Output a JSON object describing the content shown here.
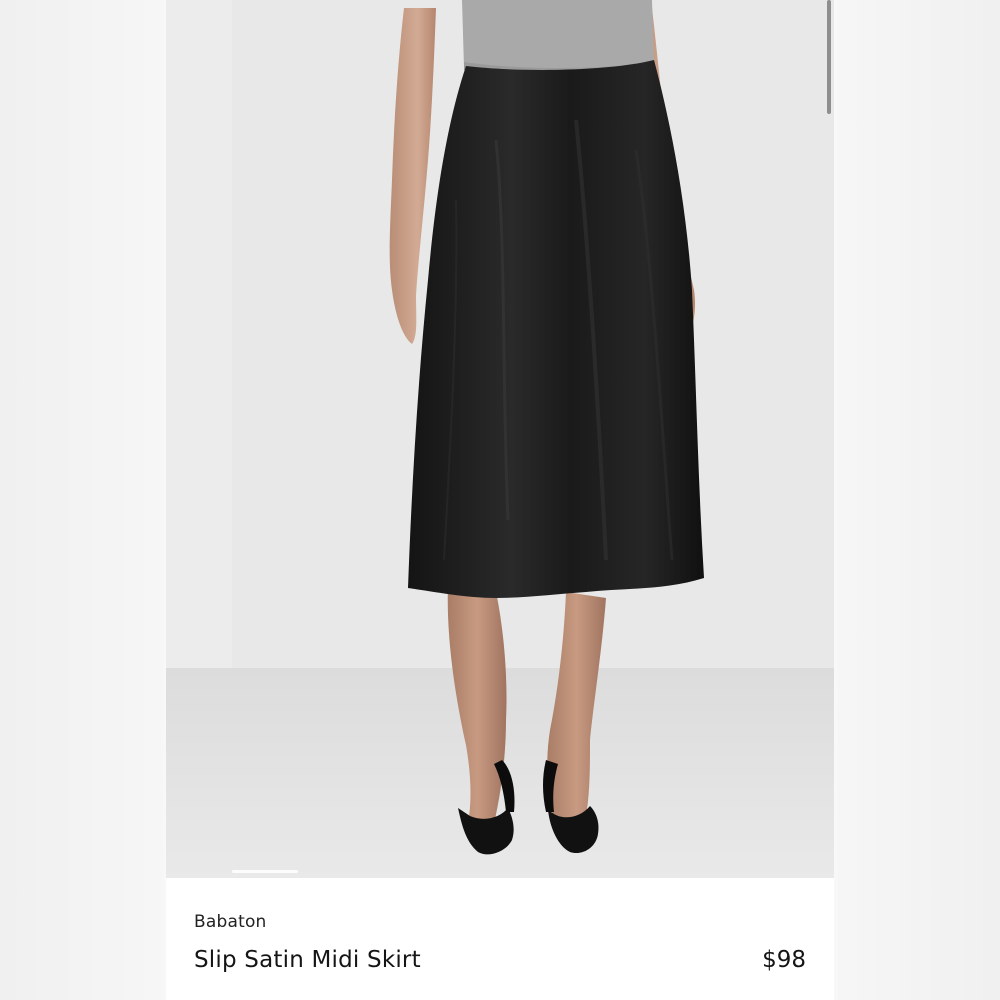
{
  "product": {
    "brand": "Babaton",
    "title": "Slip Satin Midi Skirt",
    "price": "$98"
  },
  "photo": {
    "alt": "Model wearing a black satin midi skirt with grey top and black heeled mules"
  },
  "colors": {
    "backdrop": "#e8e8e8",
    "skirt": "#1c1c1c",
    "top": "#a9a9a9",
    "skin": "#c9a08a",
    "shoes": "#111111",
    "text": "#151515"
  },
  "icons": {
    "scrollbar": "scrollbar-thumb",
    "carousel": "carousel-indicator"
  }
}
